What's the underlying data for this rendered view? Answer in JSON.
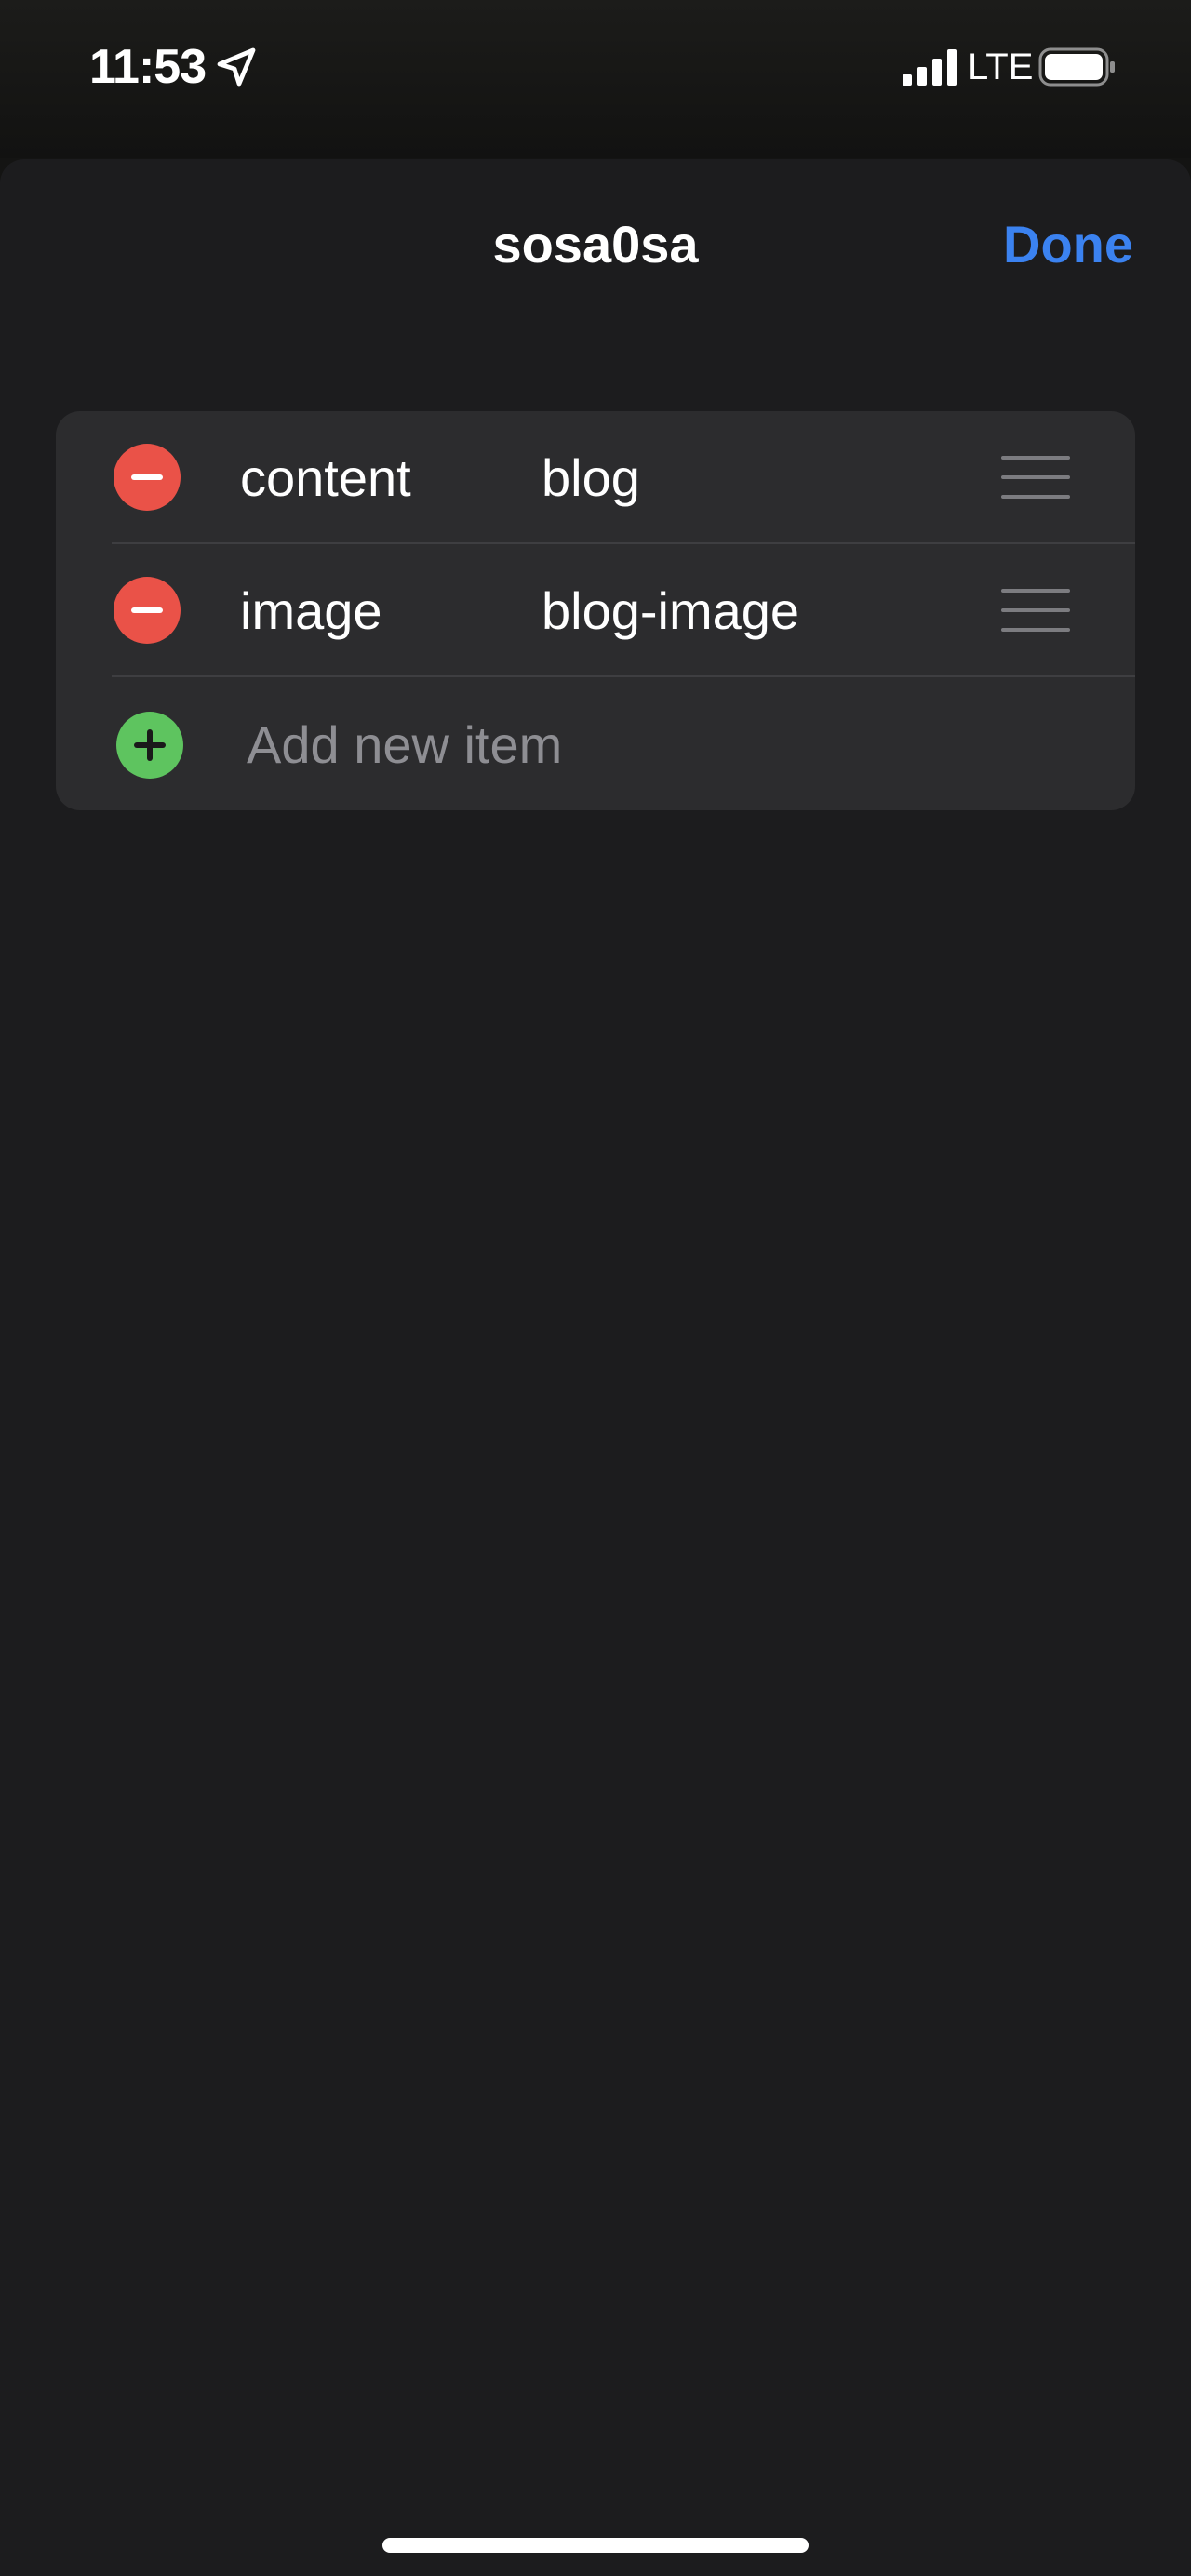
{
  "status_bar": {
    "time": "11:53",
    "network": "LTE",
    "icons": [
      "location-arrow-icon",
      "cellular-signal-icon",
      "battery-icon"
    ]
  },
  "sheet": {
    "title": "sosa0sa",
    "done_label": "Done"
  },
  "list": {
    "items": [
      {
        "key": "content",
        "value": "blog"
      },
      {
        "key": "image",
        "value": "blog-image"
      }
    ],
    "add_placeholder": "Add new item"
  },
  "colors": {
    "accent": "#3b82f0",
    "remove": "#ea5248",
    "add": "#5ec45f",
    "sheet_bg": "#1c1c1e",
    "card_bg": "#2c2c2e"
  }
}
